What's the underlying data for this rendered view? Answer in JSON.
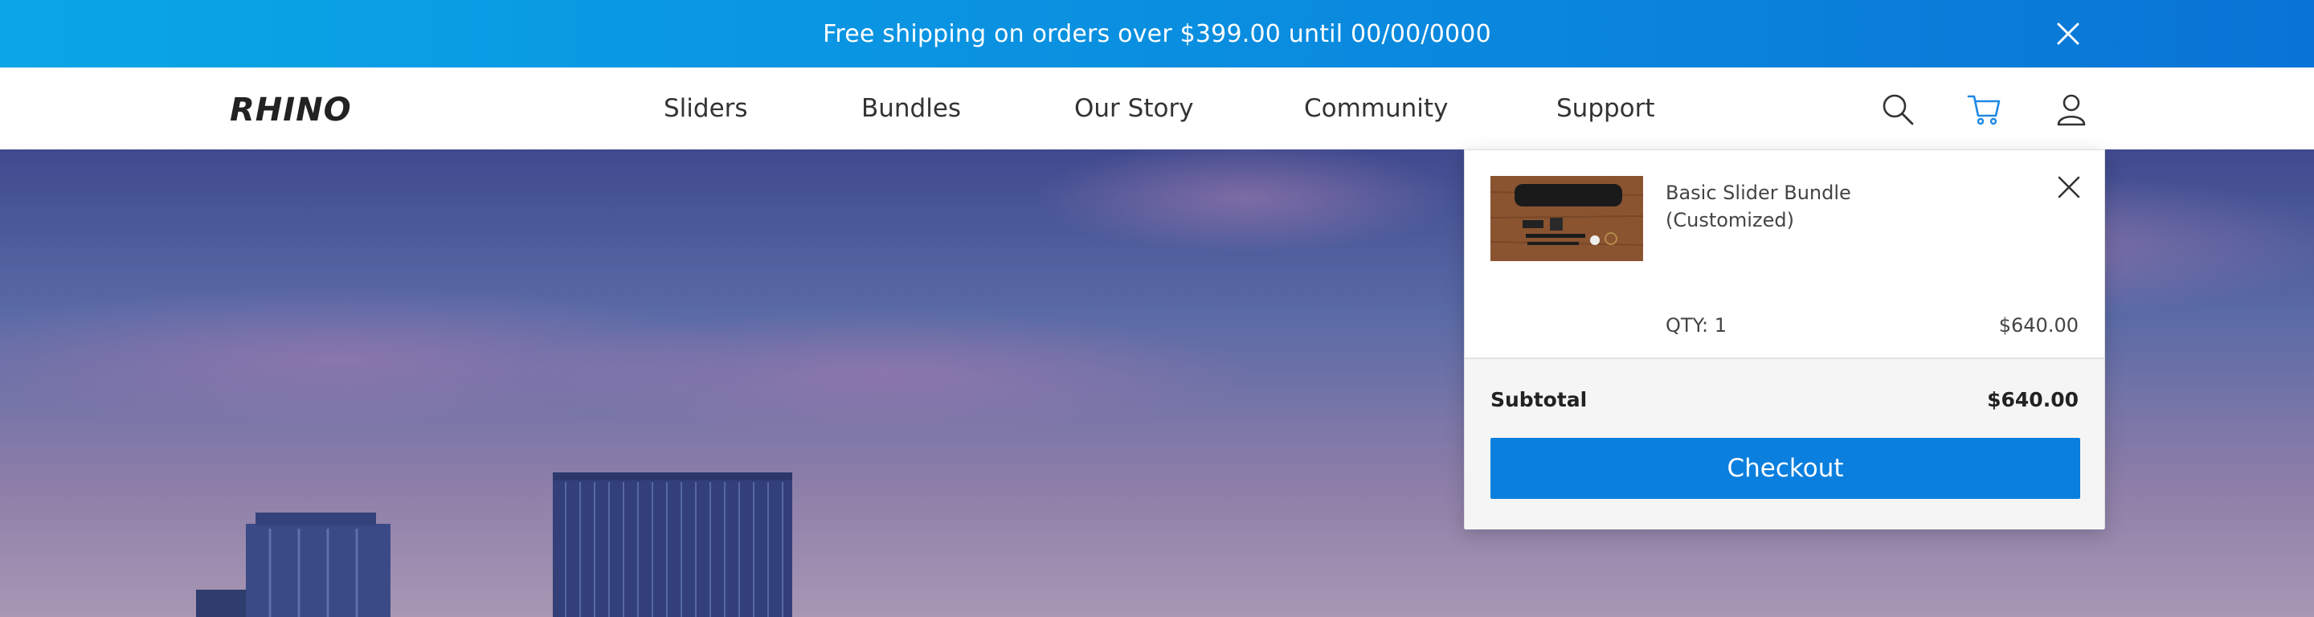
{
  "announcement": {
    "text": "Free shipping on orders over $399.00 until 00/00/0000",
    "close_icon": "close-icon"
  },
  "header": {
    "logo_text": "RHINO",
    "menu": [
      {
        "label": "Sliders"
      },
      {
        "label": "Bundles"
      },
      {
        "label": "Our Story"
      },
      {
        "label": "Community"
      },
      {
        "label": "Support"
      }
    ],
    "icons": [
      "search-icon",
      "cart-icon",
      "account-icon"
    ]
  },
  "cart": {
    "items": [
      {
        "name": "Basic Slider Bundle (Customized)",
        "qty_text": "QTY: 1",
        "price": "$640.00"
      }
    ],
    "subtotal_label": "Subtotal",
    "subtotal_value": "$640.00",
    "checkout_label": "Checkout"
  },
  "colors": {
    "accent": "#0b7fde",
    "banner_start": "#0aa6e6",
    "banner_end": "#0a74d6",
    "cart_icon": "#1e88e5"
  }
}
